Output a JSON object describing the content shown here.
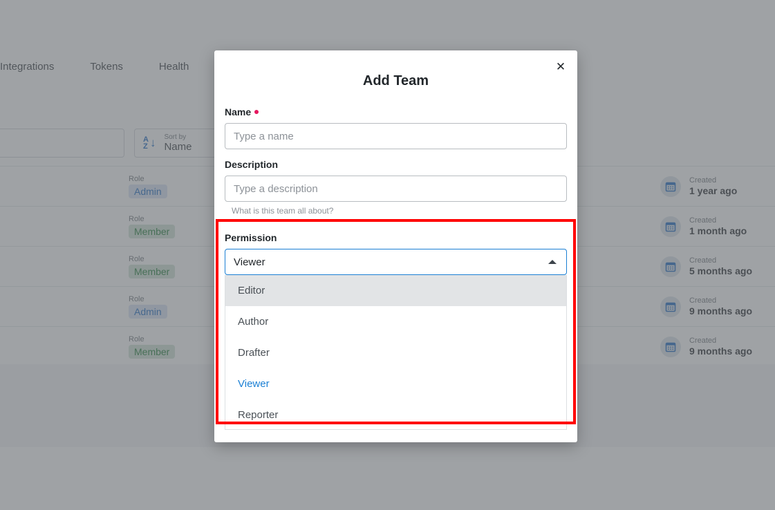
{
  "background": {
    "nav_tabs": [
      {
        "label": "Integrations"
      },
      {
        "label": "Tokens"
      },
      {
        "label": "Health"
      }
    ],
    "search": {
      "value": "",
      "placeholder": ""
    },
    "sort": {
      "label": "Sort by",
      "value": "Name",
      "icon": "sort-az-icon"
    },
    "table": {
      "role_header": "Role",
      "created_header": "Created",
      "rows": [
        {
          "role": "Admin",
          "role_type": "admin",
          "created_label": "Created",
          "created_value": "1 year ago"
        },
        {
          "role": "Member",
          "role_type": "member",
          "created_label": "Created",
          "created_value": "1 month ago"
        },
        {
          "role": "Member",
          "role_type": "member",
          "created_label": "Created",
          "created_value": "5 months ago"
        },
        {
          "role": "Admin",
          "role_type": "admin",
          "created_label": "Created",
          "created_value": "9 months ago"
        },
        {
          "role": "Member",
          "role_type": "member",
          "created_label": "Created",
          "created_value": "9 months ago"
        }
      ]
    }
  },
  "modal": {
    "title": "Add Team",
    "close_icon": "close-icon",
    "name_field": {
      "label": "Name",
      "required": true,
      "value": "",
      "placeholder": "Type a name"
    },
    "description_field": {
      "label": "Description",
      "value": "",
      "placeholder": "Type a description",
      "help": "What is this team all about?"
    },
    "permission_field": {
      "label": "Permission",
      "selected": "Viewer",
      "caret_icon": "caret-up-icon",
      "options": [
        {
          "label": "Editor",
          "state": "highlighted"
        },
        {
          "label": "Author",
          "state": "normal"
        },
        {
          "label": "Drafter",
          "state": "normal"
        },
        {
          "label": "Viewer",
          "state": "selected"
        },
        {
          "label": "Reporter",
          "state": "normal"
        }
      ]
    }
  },
  "annotation": {
    "highlight_color": "#ff0000",
    "target": "permission-dropdown"
  },
  "colors": {
    "accent_blue": "#1a7fd4",
    "required_pink": "#e5175e",
    "badge_admin_text": "#1565c0",
    "badge_member_text": "#1b7a33",
    "highlight_red": "#ff0000"
  }
}
